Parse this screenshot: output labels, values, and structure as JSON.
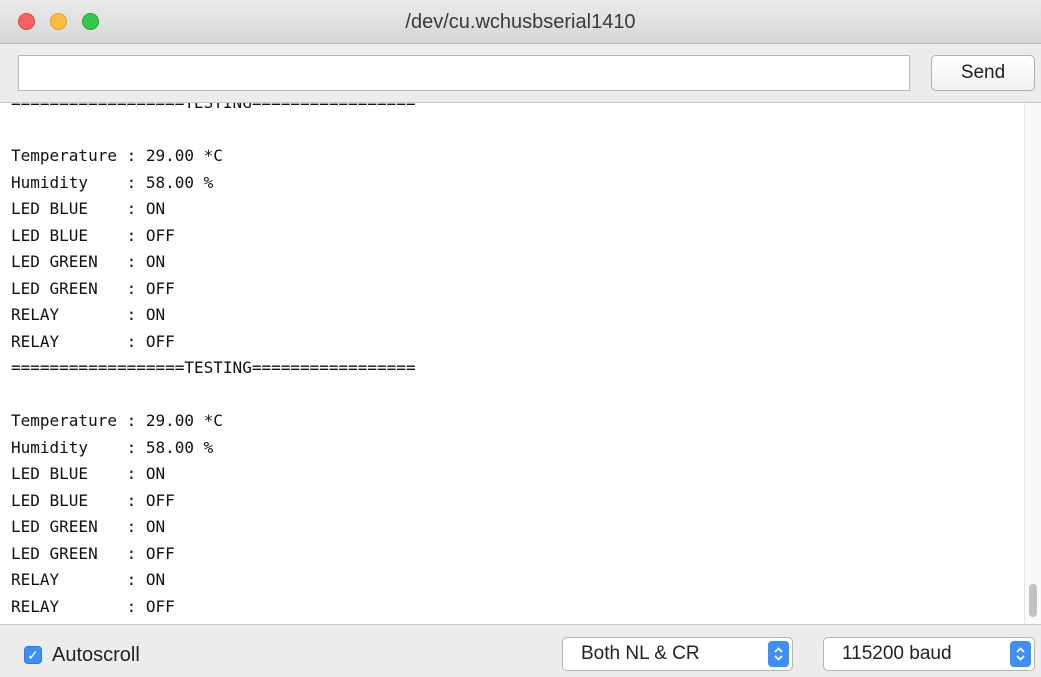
{
  "window": {
    "title": "/dev/cu.wchusbserial1410"
  },
  "input": {
    "value": "",
    "send_label": "Send"
  },
  "output": {
    "lines": [
      "==================TESTING=================",
      "",
      "Temperature : 29.00 *C",
      "Humidity    : 58.00 %",
      "LED BLUE    : ON",
      "LED BLUE    : OFF",
      "LED GREEN   : ON",
      "LED GREEN   : OFF",
      "RELAY       : ON",
      "RELAY       : OFF",
      "==================TESTING=================",
      "",
      "Temperature : 29.00 *C",
      "Humidity    : 58.00 %",
      "LED BLUE    : ON",
      "LED BLUE    : OFF",
      "LED GREEN   : ON",
      "LED GREEN   : OFF",
      "RELAY       : ON",
      "RELAY       : OFF"
    ]
  },
  "footer": {
    "autoscroll_label": "Autoscroll",
    "autoscroll_checked": true,
    "line_ending": "Both NL & CR",
    "baud_rate": "115200 baud"
  },
  "colors": {
    "accent": "#3b8ff6",
    "close": "#fc605c",
    "minimize": "#fdbc40",
    "maximize": "#34c84a"
  },
  "icons": {
    "checkbox": "checkmark-icon",
    "stepper": "chevron-up-down-icon"
  }
}
